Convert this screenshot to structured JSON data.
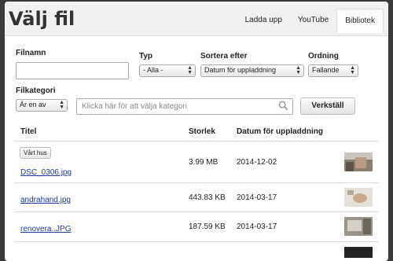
{
  "dialog": {
    "title": "Välj fil",
    "tabs": [
      {
        "label": "Ladda upp",
        "active": false
      },
      {
        "label": "YouTube",
        "active": false
      },
      {
        "label": "Bibliotek",
        "active": true
      }
    ]
  },
  "filters": {
    "filename": {
      "label": "Filnamn",
      "value": ""
    },
    "type": {
      "label": "Typ",
      "value": "- Alla -"
    },
    "sort": {
      "label": "Sortera efter",
      "value": "Datum för uppladdning"
    },
    "order": {
      "label": "Ordning",
      "value": "Fallande"
    },
    "category": {
      "label": "Filkategori",
      "mode": "Är en av",
      "placeholder": "Klicka här för att välja kategori"
    },
    "apply_label": "Verkställ"
  },
  "table": {
    "headers": {
      "title": "Titel",
      "size": "Storlek",
      "date": "Datum för uppladdning"
    },
    "rows": [
      {
        "tag": "Vårt hus",
        "name": "DSC_0306.jpg",
        "size": "3.99 MB",
        "date": "2014-12-02"
      },
      {
        "tag": "",
        "name": "andrahand.jpg",
        "size": "443.83 KB",
        "date": "2014-03-17"
      },
      {
        "tag": "",
        "name": "renovera..JPG",
        "size": "187.59 KB",
        "date": "2014-03-17"
      }
    ]
  },
  "colors": {
    "link": "#1a3a9e",
    "backdrop": "#3a3a3a"
  }
}
